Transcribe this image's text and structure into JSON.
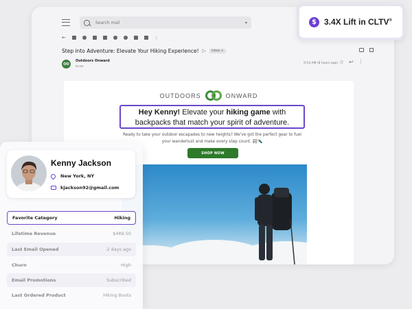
{
  "email": {
    "search_placeholder": "Search mail",
    "subject": "Step into Adventure: Elevate Your Hiking Experience!",
    "inbox_label": "Inbox",
    "sender_name": "Outdoors Onward",
    "sender_to": "to me",
    "time": "9:14 AM (8 hours ago)",
    "brand_left": "OUTDOORS",
    "brand_right": "ONWARD",
    "headline_1": "Hey Kenny!",
    "headline_2": " Elevate your ",
    "headline_3": "hiking game",
    "headline_4": " with",
    "headline_5": "backpacks that match your spirit of adventure.",
    "body": "Ready to take your outdoor escapades to new heights? We've got the perfect gear to fuel your wanderlust and make every step count. 🏞🔦",
    "button": "SHOP NOW"
  },
  "badge": {
    "text": "3.4X Lift in CLTV",
    "mark": "®"
  },
  "profile": {
    "name": "Kenny Jackson",
    "location": "New York, NY",
    "email": "kjackson92@gmail.com",
    "attributes": [
      {
        "key": "Favorite Category",
        "value": "Hiking"
      },
      {
        "key": "Lifetime Revenue",
        "value": "$489.50"
      },
      {
        "key": "Last Email Opened",
        "value": "2 days ago"
      },
      {
        "key": "Churn",
        "value": "High"
      },
      {
        "key": "Email Promotions",
        "value": "Subscribed"
      },
      {
        "key": "Last Ordered Product",
        "value": "Hiking Boots"
      }
    ]
  },
  "colors": {
    "accent": "#6a47c8",
    "brand_green": "#2d7a2b"
  }
}
